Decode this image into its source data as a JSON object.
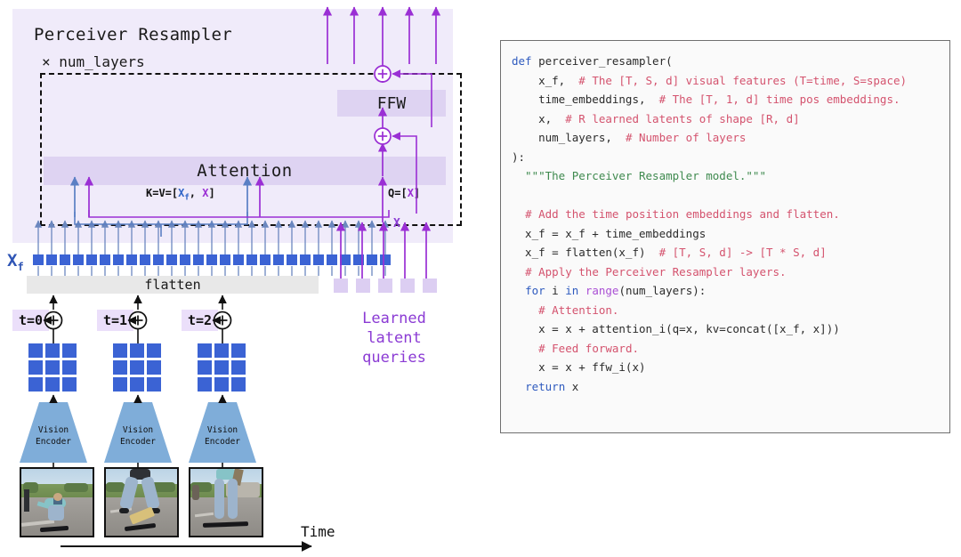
{
  "diagram": {
    "panel": {
      "title": "Perceiver Resampler",
      "multiplier": "× num_layers"
    },
    "blocks": {
      "attention": "Attention",
      "ffw": "FFW",
      "flatten": "flatten"
    },
    "labels": {
      "kv_prefix": "K=V=[",
      "kv_xf": "X",
      "kv_xf_sub": "f",
      "kv_mid": ", ",
      "kv_x": "X",
      "kv_suffix": "]",
      "q_prefix": "Q=[",
      "q_x": "X",
      "q_suffix": "]",
      "residual_x": "X",
      "xf_main": "X",
      "xf_sub": "f",
      "time_axis": "Time",
      "learned_latent_queries": "Learned\nlatent\nqueries"
    },
    "timesteps": [
      {
        "label": "t=0",
        "encoder_line1": "Vision",
        "encoder_line2": "Encoder"
      },
      {
        "label": "t=1",
        "encoder_line1": "Vision",
        "encoder_line2": "Encoder"
      },
      {
        "label": "t=2",
        "encoder_line1": "Vision",
        "encoder_line2": "Encoder"
      }
    ],
    "counts": {
      "xf_tokens": 27,
      "latent_queries": 5,
      "patch_grid_rows": 3,
      "patch_grid_cols": 3,
      "frames": 3
    },
    "colors": {
      "panel_background": "#f0ebfa",
      "block_fill": "#ded3f2",
      "latent_fill": "#dccef2",
      "patch_blue": "#3b63d4",
      "arrow_blue": "#5a7fc4",
      "arrow_purple": "#9a2fd4",
      "encoder_blue": "#7fadd9",
      "flatten_gray": "#e8e8e8",
      "xf_label_blue": "#2f55b5",
      "latent_text_purple": "#8b3bd4"
    }
  },
  "code": {
    "language": "python",
    "colors": {
      "keyword": "#2f5bbf",
      "comment": "#d4536e",
      "docstring": "#3f8a4f",
      "builtin": "#a94fd4",
      "plain": "#2b2b2b",
      "background": "#fafafa",
      "border": "#6f6f6f"
    },
    "lines": [
      [
        {
          "t": "def ",
          "c": "kw"
        },
        {
          "t": "perceiver_resampler(",
          "c": "fn"
        }
      ],
      [
        {
          "t": "    x_f,  ",
          "c": "plain"
        },
        {
          "t": "# The [T, S, d] visual features (T=time, S=space)",
          "c": "com"
        }
      ],
      [
        {
          "t": "    time_embeddings,  ",
          "c": "plain"
        },
        {
          "t": "# The [T, 1, d] time pos embeddings.",
          "c": "com"
        }
      ],
      [
        {
          "t": "    x,  ",
          "c": "plain"
        },
        {
          "t": "# R learned latents of shape [R, d]",
          "c": "com"
        }
      ],
      [
        {
          "t": "    num_layers,  ",
          "c": "plain"
        },
        {
          "t": "# Number of layers",
          "c": "com"
        }
      ],
      [
        {
          "t": "):",
          "c": "plain"
        }
      ],
      [
        {
          "t": "  \"\"\"The Perceiver Resampler model.\"\"\"",
          "c": "doc"
        }
      ],
      [
        {
          "t": "",
          "c": "plain"
        }
      ],
      [
        {
          "t": "  ",
          "c": "plain"
        },
        {
          "t": "# Add the time position embeddings and flatten.",
          "c": "com"
        }
      ],
      [
        {
          "t": "  x_f = x_f + time_embeddings",
          "c": "plain"
        }
      ],
      [
        {
          "t": "  x_f = flatten(x_f)  ",
          "c": "plain"
        },
        {
          "t": "# [T, S, d] -> [T * S, d]",
          "c": "com"
        }
      ],
      [
        {
          "t": "  ",
          "c": "plain"
        },
        {
          "t": "# Apply the Perceiver Resampler layers.",
          "c": "com"
        }
      ],
      [
        {
          "t": "  ",
          "c": "plain"
        },
        {
          "t": "for ",
          "c": "kw"
        },
        {
          "t": "i ",
          "c": "plain"
        },
        {
          "t": "in ",
          "c": "kw"
        },
        {
          "t": "range",
          "c": "builtin"
        },
        {
          "t": "(num_layers):",
          "c": "plain"
        }
      ],
      [
        {
          "t": "    ",
          "c": "plain"
        },
        {
          "t": "# Attention.",
          "c": "com"
        }
      ],
      [
        {
          "t": "    x = x + attention_i(q=x, kv=concat([x_f, x]))",
          "c": "plain"
        }
      ],
      [
        {
          "t": "    ",
          "c": "plain"
        },
        {
          "t": "# Feed forward.",
          "c": "com"
        }
      ],
      [
        {
          "t": "    x = x + ffw_i(x)",
          "c": "plain"
        }
      ],
      [
        {
          "t": "  ",
          "c": "plain"
        },
        {
          "t": "return ",
          "c": "kw"
        },
        {
          "t": "x",
          "c": "plain"
        }
      ]
    ]
  }
}
